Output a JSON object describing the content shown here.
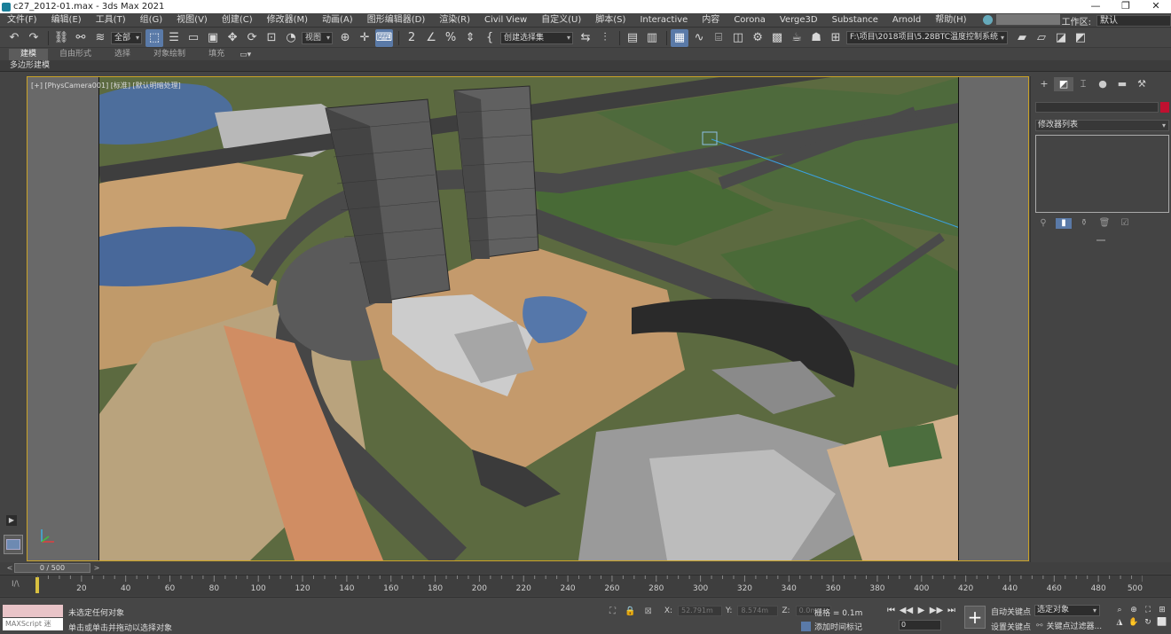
{
  "window": {
    "title": "c27_2012-01.max - 3ds Max 2021",
    "controls": [
      "—",
      "❐",
      "✕"
    ]
  },
  "menu": {
    "items": [
      "文件(F)",
      "编辑(E)",
      "工具(T)",
      "组(G)",
      "视图(V)",
      "创建(C)",
      "修改器(M)",
      "动画(A)",
      "图形编辑器(D)",
      "渲染(R)",
      "Civil View",
      "自定义(U)",
      "脚本(S)",
      "Interactive",
      "内容",
      "Corona",
      "Verge3D",
      "Substance",
      "Arnold",
      "帮助(H)"
    ],
    "workspace_label": "工作区:",
    "workspace_value": "默认"
  },
  "toolbar": {
    "selection_filter": "全部",
    "ref_coord": "视图",
    "named_selection": "创建选择集",
    "project_path": "F:\\项目\\2018项目\\5.28BTC温度控制系统"
  },
  "ribbon": {
    "tabs": [
      "建模",
      "自由形式",
      "选择",
      "对象绘制",
      "填充"
    ],
    "sub_label": "多边形建模"
  },
  "viewport": {
    "label": "[+] [PhysCamera001] [标准] [默认明暗处理]"
  },
  "command_panel": {
    "modifier_list": "修改器列表"
  },
  "timeline": {
    "slider": "0 / 500",
    "ticks": [
      20,
      40,
      60,
      80,
      100,
      120,
      140,
      160,
      180,
      200,
      220,
      240,
      260,
      280,
      300,
      320,
      340,
      360,
      380,
      400,
      420,
      440,
      460,
      480,
      500
    ]
  },
  "status": {
    "maxscript": "MAXScript 迷",
    "line1": "未选定任何对象",
    "line2": "单击或单击并拖动以选择对象",
    "x_label": "X:",
    "x_value": "52.791m",
    "y_label": "Y:",
    "y_value": "8.574m",
    "z_label": "Z:",
    "z_value": "0.0m",
    "grid": "栅格 = 0.1m",
    "add_time_tag": "添加时间标记",
    "frame": "0",
    "auto_key": "自动关键点",
    "set_key": "设置关键点",
    "selected": "选定对象",
    "key_filters": "关键点过滤器..."
  },
  "colors": {
    "accent": "#5a7aa8",
    "viewport_border": "#c9a227",
    "frame_pointer": "#d8c040"
  }
}
